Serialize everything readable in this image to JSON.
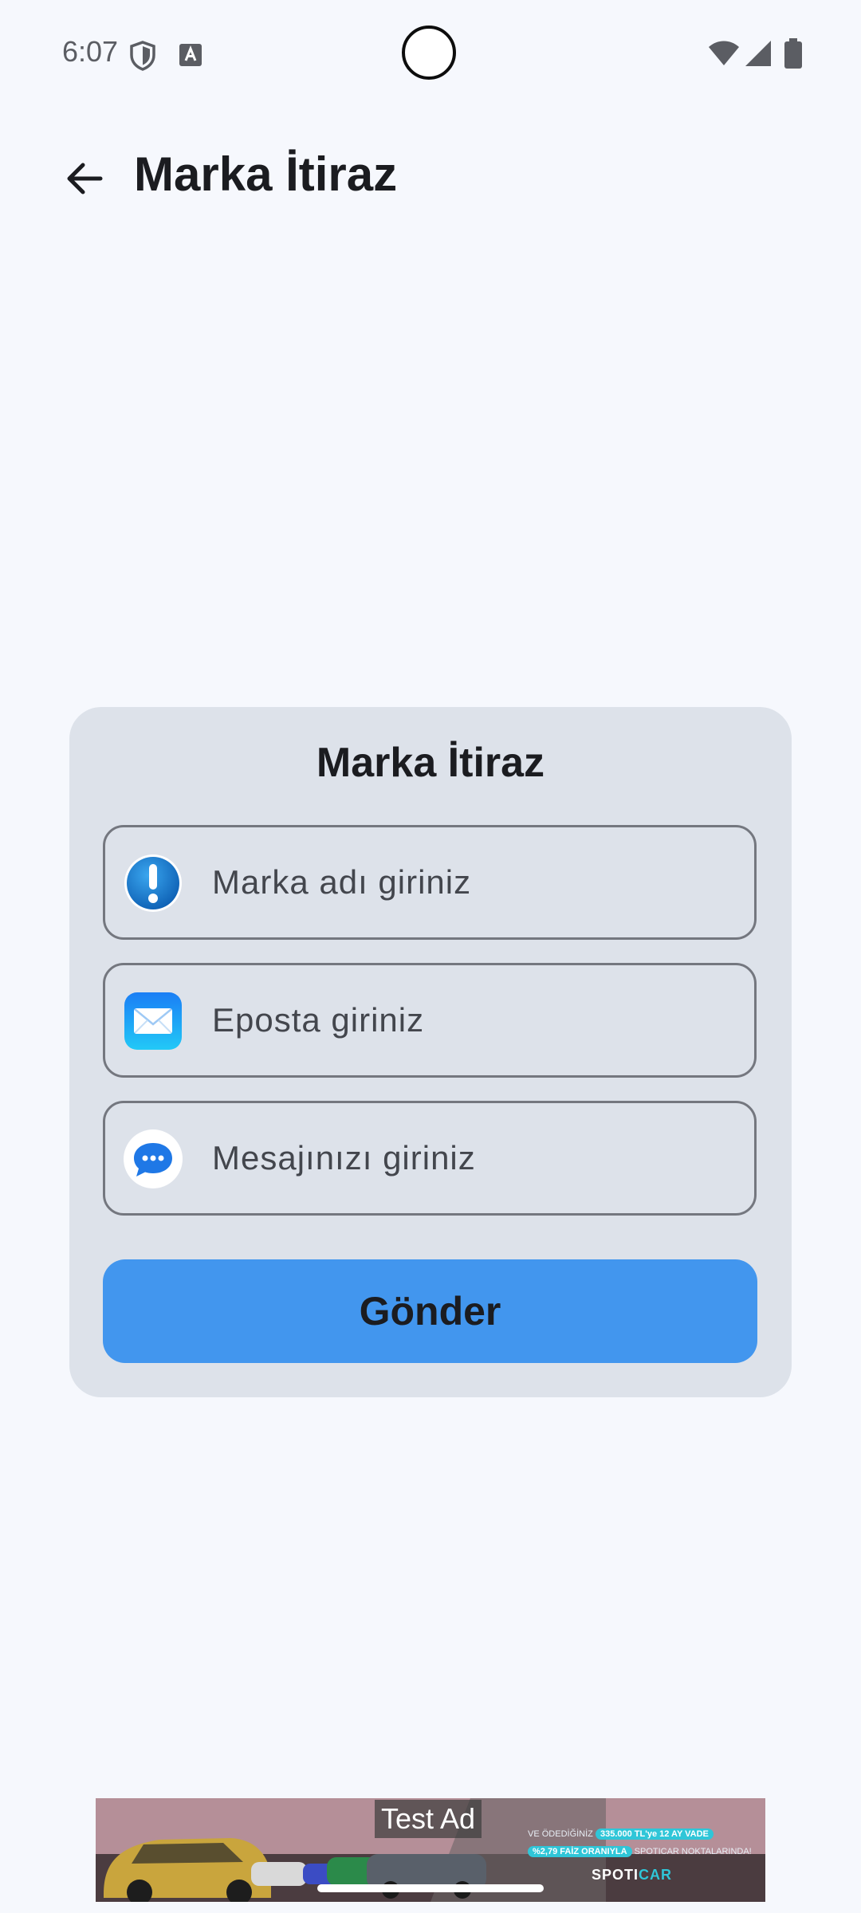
{
  "status_bar": {
    "time": "6:07"
  },
  "app_bar": {
    "title": "Marka İtiraz"
  },
  "form": {
    "title": "Marka İtiraz",
    "fields": [
      {
        "placeholder": "Marka adı giriniz",
        "value": "",
        "icon": "exclamation-icon"
      },
      {
        "placeholder": "Eposta giriniz",
        "value": "",
        "icon": "mail-icon"
      },
      {
        "placeholder": "Mesajınızı giriniz",
        "value": "",
        "icon": "chat-bubble-icon"
      }
    ],
    "submit_label": "Gönder"
  },
  "ad": {
    "label": "Test Ad",
    "line1_prefix": "VE ÖDEDİĞİNİZ",
    "line1_highlight": "335.000 TL'ye 12 AY VADE",
    "line2_highlight": "%2,79 FAİZ ORANIYLA",
    "line2_suffix": "SPOTICAR NOKTALARINDA!",
    "brand_part1": "SPOTI",
    "brand_part2": "CAR"
  },
  "colors": {
    "background": "#f6f8fd",
    "card": "#dde2ea",
    "primary_button": "#4296ee",
    "text": "#1b1c20",
    "outline": "#74777f"
  }
}
